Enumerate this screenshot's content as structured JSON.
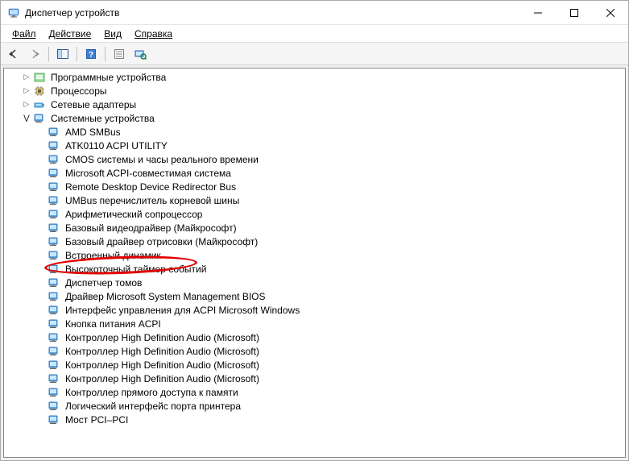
{
  "window": {
    "title": "Диспетчер устройств"
  },
  "menu": {
    "file": "Файл",
    "action": "Действие",
    "view": "Вид",
    "help": "Справка"
  },
  "tree": {
    "software_devices": "Программные устройства",
    "processors": "Процессоры",
    "network_adapters": "Сетевые адаптеры",
    "system_devices": "Системные устройства",
    "children": {
      "amd_smbus": "AMD SMBus",
      "atk": "ATK0110 ACPI UTILITY",
      "cmos": "CMOS системы и часы реального времени",
      "ms_acpi": "Microsoft ACPI-совместимая система",
      "rdp_redir": "Remote Desktop Device Redirector Bus",
      "umbus": "UMBus перечислитель корневой шины",
      "arith": "Арифметический сопроцессор",
      "basic_video": "Базовый видеодрайвер (Майкрософт)",
      "basic_render": "Базовый драйвер отрисовки (Майкрософт)",
      "builtin_speaker": "Встроенный динамик",
      "hpet": "Высокоточный таймер событий",
      "volmgr": "Диспетчер томов",
      "smbios": "Драйвер Microsoft System Management BIOS",
      "acpi_iface": "Интерфейс управления для ACPI Microsoft Windows",
      "pwr_btn": "Кнопка питания ACPI",
      "hd_audio_1": "Контроллер High Definition Audio (Microsoft)",
      "hd_audio_2": "Контроллер High Definition Audio (Microsoft)",
      "hd_audio_3": "Контроллер High Definition Audio (Microsoft)",
      "hd_audio_4": "Контроллер High Definition Audio (Microsoft)",
      "dma": "Контроллер прямого доступа к памяти",
      "printer_port": "Логический интерфейс порта принтера",
      "pci_bridge": "Мост PCI–PCI"
    }
  },
  "annotation": {
    "circled_item": "builtin_speaker"
  }
}
